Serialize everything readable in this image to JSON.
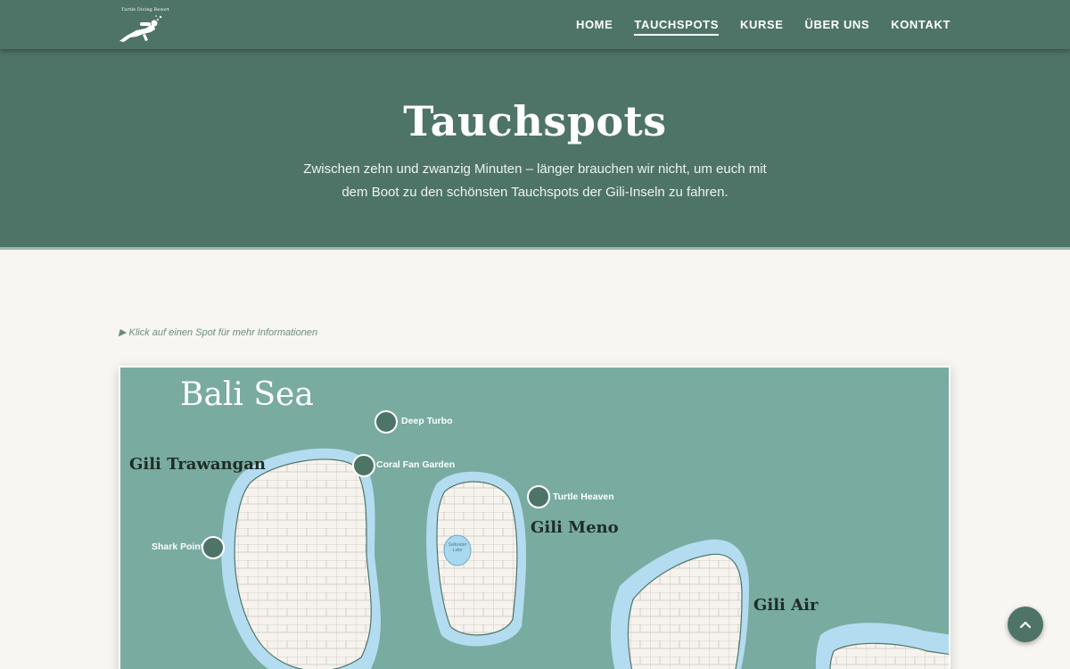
{
  "brand": {
    "logo_text": "Turtle Diving Resort",
    "logo_icon": "diver-icon"
  },
  "nav": [
    {
      "label": "HOME",
      "active": false
    },
    {
      "label": "TAUCHSPOTS",
      "active": true
    },
    {
      "label": "KURSE",
      "active": false
    },
    {
      "label": "ÜBER UNS",
      "active": false
    },
    {
      "label": "KONTAKT",
      "active": false
    }
  ],
  "hero": {
    "title": "Tauchspots",
    "subtitle": "Zwischen zehn und zwanzig Minuten – länger brauchen wir nicht, um euch mit dem Boot zu den schönsten Tauchspots der Gili-Inseln zu fahren."
  },
  "hint": "▶ Klick auf einen Spot für mehr Informationen",
  "map": {
    "sea_label": "Bali Sea",
    "islands": {
      "trawangan": "Gili Trawangan",
      "meno": "Gili Meno",
      "air": "Gili Air"
    },
    "lake_label": "Saltwater Lake",
    "spots": {
      "deep_turbo": "Deep Turbo",
      "coral_fan_garden": "Coral Fan Garden",
      "turtle_heaven": "Turtle Heaven",
      "shark_point": "Shark Point"
    }
  },
  "colors": {
    "primary": "#4e7467",
    "sea": "#79aba1",
    "shallow": "#b4dcf0",
    "land": "#f6f3ee",
    "background": "#f8f6f2"
  },
  "back_to_top_icon": "chevron-up-icon"
}
